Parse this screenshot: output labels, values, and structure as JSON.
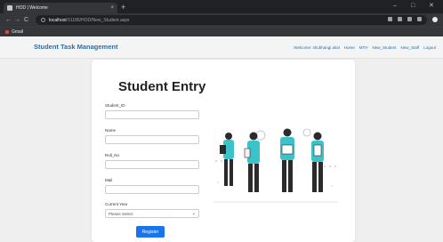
{
  "browser": {
    "tab_title": "HOD | Welcome",
    "tab_close": "×",
    "new_tab": "+",
    "url_host": "localhost",
    "url_path": ":51185/HOD/New_Student.aspx",
    "bookmark": "Gmail",
    "controls": {
      "minimize": "–",
      "maximize": "□",
      "close": "✕",
      "back": "←",
      "forward": "→",
      "reload": "C"
    }
  },
  "site": {
    "brand": "Student Task Management",
    "nav": [
      "Welcome: shubhangi akal",
      "Home",
      "MTH",
      "New_Student",
      "New_Staff",
      "Logout"
    ]
  },
  "form": {
    "heading": "Student Entry",
    "fields": [
      {
        "label": "Student_ID",
        "value": ""
      },
      {
        "label": "Name",
        "value": ""
      },
      {
        "label": "Roll_No",
        "value": ""
      },
      {
        "label": "Mail",
        "value": ""
      }
    ],
    "year": {
      "label": "Current Year",
      "selected": "Please Select",
      "arrow": "⌄"
    },
    "submit_label": "Register"
  },
  "colors": {
    "brand": "#2c6ea8",
    "button": "#1a73e8",
    "accent_teal": "#3cc3c9"
  },
  "icons": [
    "favicon-icon",
    "close-icon",
    "new-tab-icon",
    "back-arrow-icon",
    "forward-arrow-icon",
    "reload-icon",
    "lock-icon",
    "extension-icon",
    "profile-icon",
    "gmail-icon",
    "chevron-down-icon"
  ]
}
